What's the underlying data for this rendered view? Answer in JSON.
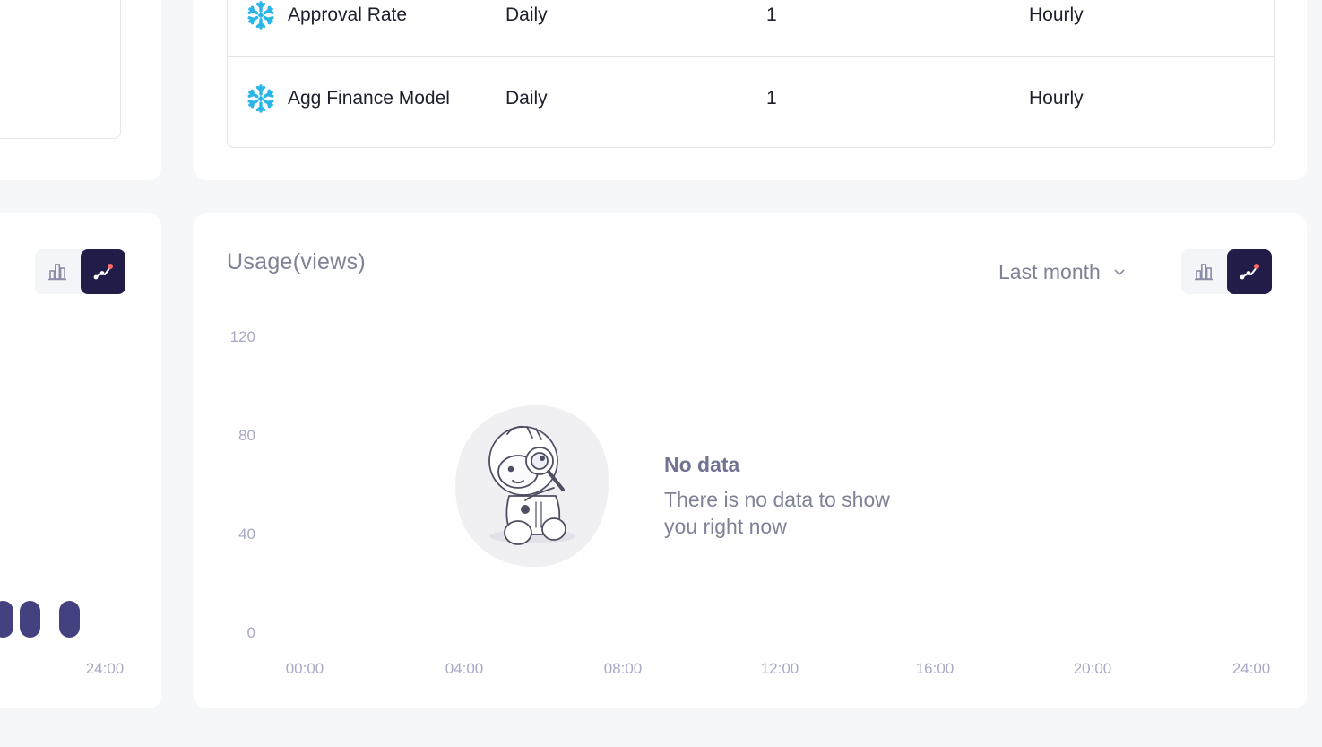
{
  "colors": {
    "page_bg": "#f6f7f9",
    "card_bg": "#ffffff",
    "accent_dark": "#221d48",
    "snowflake_blue": "#29b5e8",
    "pill": "#444180"
  },
  "table": {
    "rows": [
      {
        "icon": "snowflake-icon",
        "name": "Approval Rate",
        "frequency": "Daily",
        "count": "1",
        "schedule": "Hourly"
      },
      {
        "icon": "snowflake-icon",
        "name": "Agg Finance Model",
        "frequency": "Daily",
        "count": "1",
        "schedule": "Hourly"
      }
    ]
  },
  "left_chart": {
    "visible_x_tick": "24:00",
    "toggle": {
      "bar_icon": "bar-chart-icon",
      "line_icon": "line-chart-icon",
      "active": "line"
    }
  },
  "usage": {
    "title": "Usage(views)",
    "period": "Last month",
    "toggle": {
      "bar_icon": "bar-chart-icon",
      "line_icon": "line-chart-icon",
      "active": "line"
    },
    "empty": {
      "title": "No data",
      "description": "There is no data to show you right now",
      "illustration": "astronaut-magnifier-illustration"
    }
  },
  "chart_data": {
    "type": "line",
    "title": "Usage(views)",
    "xlabel": "",
    "ylabel": "",
    "x_ticks": [
      "00:00",
      "04:00",
      "08:00",
      "12:00",
      "16:00",
      "20:00",
      "24:00"
    ],
    "y_ticks": [
      "120",
      "80",
      "40",
      "0"
    ],
    "ylim": [
      0,
      120
    ],
    "series": [],
    "grid": false,
    "empty_state": true
  }
}
